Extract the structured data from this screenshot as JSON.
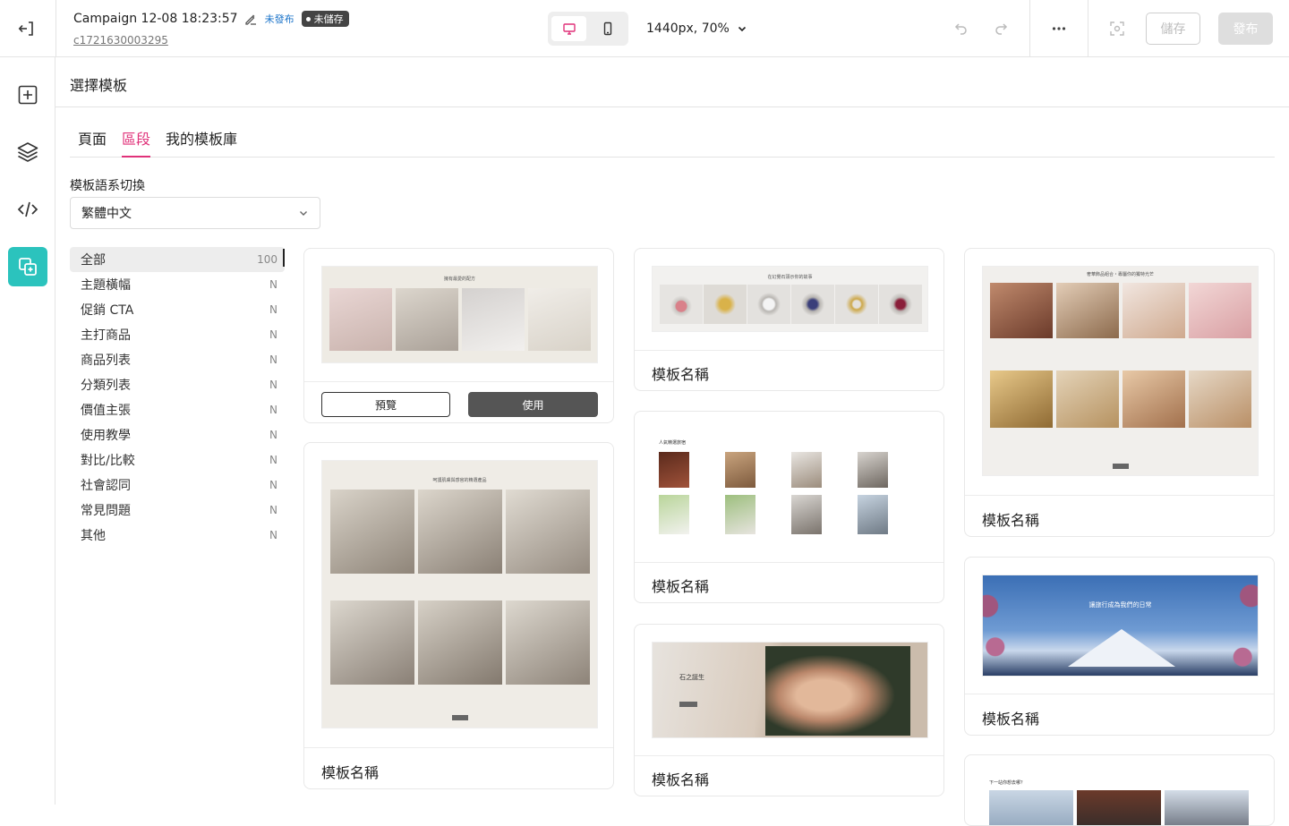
{
  "topbar": {
    "campaign_title": "Campaign 12-08 18:23:57",
    "badge_unpublished": "未發布",
    "badge_unsaved": "未儲存",
    "campaign_id": "c1721630003295",
    "zoom": "1440px, 70%",
    "save_label": "儲存",
    "publish_label": "發布",
    "colors": {
      "accent": "#e0327a",
      "rail_active": "#2bc3bd",
      "unpublished": "#1a73c9"
    }
  },
  "rail": {
    "icons": [
      "add-section-icon",
      "layers-icon",
      "code-icon",
      "template-library-icon"
    ]
  },
  "panel": {
    "title": "選擇模板",
    "tabs": [
      "頁面",
      "區段",
      "我的模板庫"
    ],
    "active_tab": "區段",
    "lang_label": "模板語系切換",
    "lang_value": "繁體中文",
    "categories": [
      {
        "label": "全部",
        "count": "100"
      },
      {
        "label": "主題橫幅",
        "count": "N"
      },
      {
        "label": "促銷 CTA",
        "count": "N"
      },
      {
        "label": "主打商品",
        "count": "N"
      },
      {
        "label": "商品列表",
        "count": "N"
      },
      {
        "label": "分類列表",
        "count": "N"
      },
      {
        "label": "價值主張",
        "count": "N"
      },
      {
        "label": "使用教學",
        "count": "N"
      },
      {
        "label": "對比/比較",
        "count": "N"
      },
      {
        "label": "社會認同",
        "count": "N"
      },
      {
        "label": "常見問題",
        "count": "N"
      },
      {
        "label": "其他",
        "count": "N"
      }
    ]
  },
  "templates": {
    "preview_label": "預覽",
    "use_label": "使用",
    "name": "模板名稱",
    "captions": {
      "skincare": "擁有最愛的配方",
      "rings": "在幻覺石頭示你的故事",
      "jewelry": "奢華飾品組合・專屬你的獨特光芒",
      "serum": "呵護肌膚與感官的精選產品",
      "hotels": "人氣精選旅宿",
      "stone_title": "石之誕生",
      "fuji": "讓旅行成為我們的日常",
      "next_trip": "下一站你想去哪？"
    }
  }
}
